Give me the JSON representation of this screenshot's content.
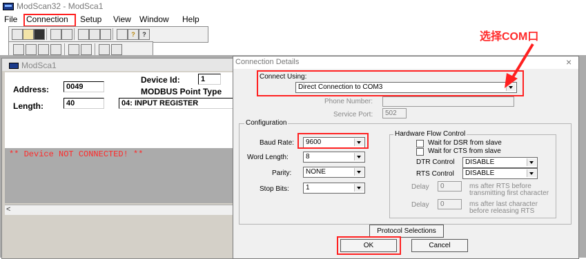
{
  "app": {
    "title": "ModScan32 - ModSca1"
  },
  "menu": [
    "File",
    "Connection",
    "Setup",
    "View",
    "Window",
    "Help"
  ],
  "annotation": {
    "text": "选择COM口",
    "color": "#ff2a2a"
  },
  "child_window": {
    "title": "ModSca1",
    "address_label": "Address:",
    "address_value": "0049",
    "length_label": "Length:",
    "length_value": "40",
    "device_id_label": "Device Id:",
    "device_id_value": "1",
    "point_type_label": "MODBUS Point Type",
    "point_type_value": "04: INPUT REGISTER",
    "status_message": "** Device NOT CONNECTED! **",
    "scroll_left": "<"
  },
  "dialog": {
    "title": "Connection Details",
    "close": "×",
    "connect_using_label": "Connect Using:",
    "connect_using_value": "Direct Connection to COM3",
    "phone_label": "Phone Number:",
    "phone_value": "",
    "service_port_label": "Service Port:",
    "service_port_value": "502",
    "configuration": {
      "label": "Configuration",
      "baud_rate_label": "Baud Rate:",
      "baud_rate_value": "9600",
      "word_length_label": "Word Length:",
      "word_length_value": "8",
      "parity_label": "Parity:",
      "parity_value": "NONE",
      "stop_bits_label": "Stop Bits:",
      "stop_bits_value": "1"
    },
    "flow_control": {
      "label": "Hardware Flow Control",
      "wait_dsr": "Wait for DSR from slave",
      "wait_cts": "Wait for CTS from slave",
      "dtr_label": "DTR Control",
      "dtr_value": "DISABLE",
      "rts_label": "RTS Control",
      "rts_value": "DISABLE",
      "delay1_label": "Delay",
      "delay1_value": "0",
      "delay1_note_1": "ms after RTS before",
      "delay1_note_2": "transmitting first character",
      "delay2_label": "Delay",
      "delay2_value": "0",
      "delay2_note_1": "ms after last character",
      "delay2_note_2": "before releasing RTS"
    },
    "protocol_button": "Protocol Selections",
    "ok_button": "OK",
    "cancel_button": "Cancel"
  },
  "highlight_color": "#ff2020"
}
